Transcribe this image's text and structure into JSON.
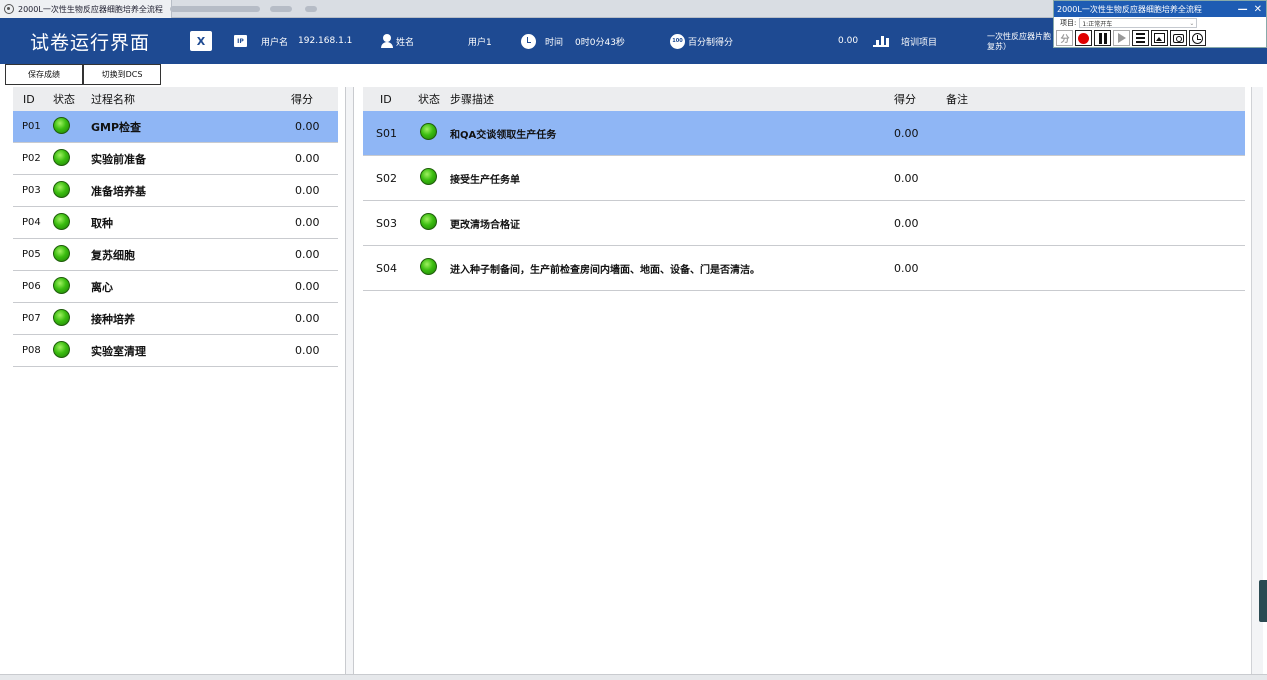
{
  "window": {
    "tab_title": "2000L一次性生物反应器细胞培养全流程"
  },
  "float_panel": {
    "title": "2000L一次性生物反应器细胞培养全流程",
    "minimize": "—",
    "close": "✕",
    "project_label": "项目:",
    "project_value": "1:正常开车",
    "score_glyph": "分"
  },
  "header": {
    "page_title": "试卷运行界面",
    "excel_glyph": "X",
    "ip_glyph": "IP",
    "username_label": "用户名",
    "username_value": "192.168.1.1",
    "name_label": "姓名",
    "name_value": "用户1",
    "time_label": "时间",
    "time_value": "0时0分43秒",
    "percent_glyph": "100",
    "percent_label": "百分制得分",
    "percent_value": "0.00",
    "training_label": "培训项目",
    "training_value": "一次性反应器片胞复苏）"
  },
  "actions": {
    "save_score": "保存成绩",
    "switch_dcs": "切换到DCS"
  },
  "process_table": {
    "headers": {
      "id": "ID",
      "status": "状态",
      "name": "过程名称",
      "score": "得分"
    },
    "rows": [
      {
        "id": "P01",
        "name": "GMP检查",
        "score": "0.00"
      },
      {
        "id": "P02",
        "name": "实验前准备",
        "score": "0.00"
      },
      {
        "id": "P03",
        "name": "准备培养基",
        "score": "0.00"
      },
      {
        "id": "P04",
        "name": "取种",
        "score": "0.00"
      },
      {
        "id": "P05",
        "name": "复苏细胞",
        "score": "0.00"
      },
      {
        "id": "P06",
        "name": "离心",
        "score": "0.00"
      },
      {
        "id": "P07",
        "name": "接种培养",
        "score": "0.00"
      },
      {
        "id": "P08",
        "name": "实验室清理",
        "score": "0.00"
      }
    ]
  },
  "step_table": {
    "headers": {
      "id": "ID",
      "status": "状态",
      "desc": "步骤描述",
      "score": "得分",
      "note": "备注"
    },
    "rows": [
      {
        "id": "S01",
        "desc": "和QA交谈领取生产任务",
        "score": "0.00",
        "note": ""
      },
      {
        "id": "S02",
        "desc": "接受生产任务单",
        "score": "0.00",
        "note": ""
      },
      {
        "id": "S03",
        "desc": "更改清场合格证",
        "score": "0.00",
        "note": ""
      },
      {
        "id": "S04",
        "desc": "进入种子制备间，生产前检查房间内墙面、地面、设备、门是否清洁。",
        "score": "0.00",
        "note": ""
      }
    ]
  },
  "colors": {
    "header_bg": "#1e4a92",
    "selected_row": "#8fb6f5",
    "status_ok": "#3bbd10",
    "record": "#e00000"
  }
}
